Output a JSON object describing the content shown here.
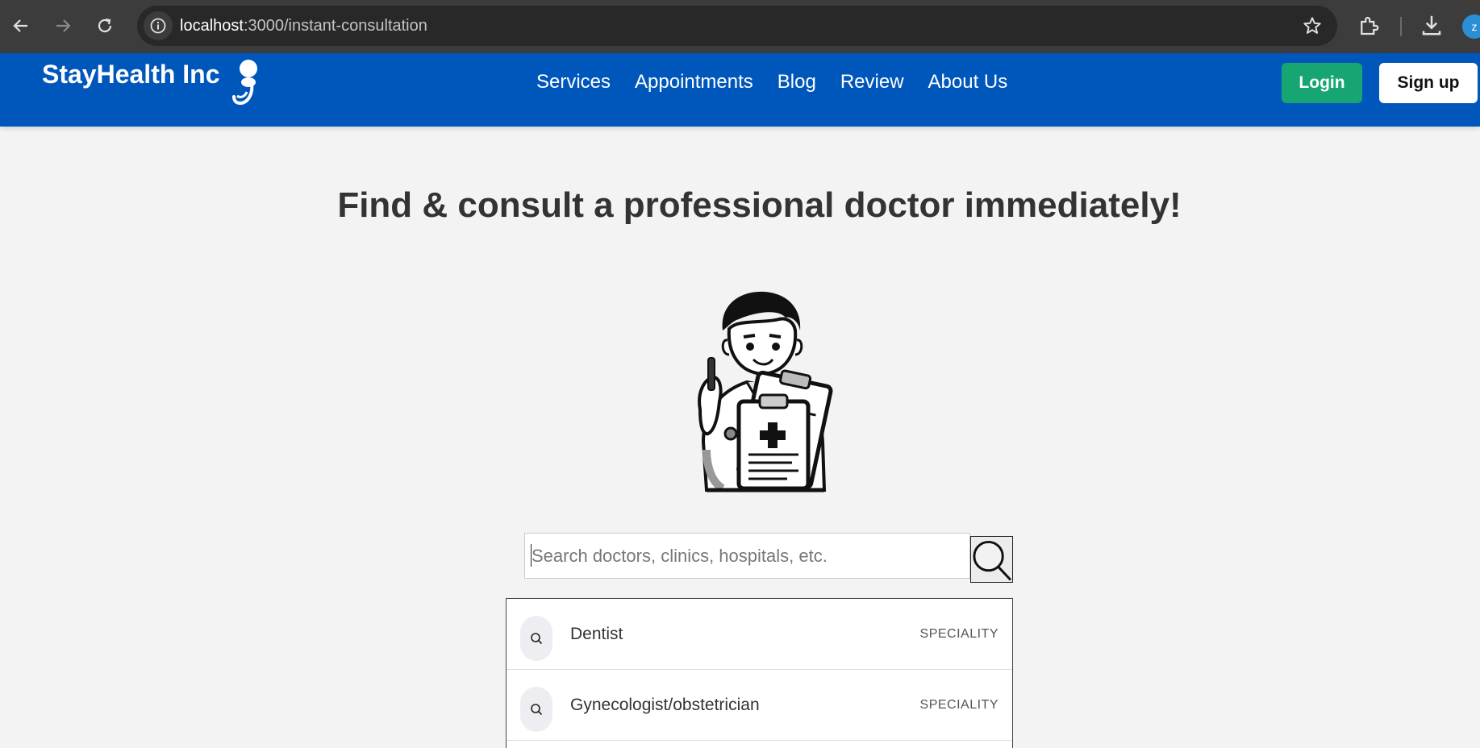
{
  "browser": {
    "url_host": "localhost",
    "url_path": ":3000/instant-consultation",
    "profile_initial": "z"
  },
  "header": {
    "brand": "StayHealth Inc",
    "nav": [
      "Services",
      "Appointments",
      "Blog",
      "Review",
      "About Us"
    ],
    "login_label": "Login",
    "signup_label": "Sign up",
    "brand_color": "#0057bb",
    "login_color": "#17a673"
  },
  "main": {
    "title": "Find & consult a professional doctor immediately!",
    "search": {
      "placeholder": "Search doctors, clinics, hospitals, etc.",
      "value": ""
    },
    "results": [
      {
        "name": "Dentist",
        "type": "SPECIALITY"
      },
      {
        "name": "Gynecologist/obstetrician",
        "type": "SPECIALITY"
      }
    ]
  }
}
